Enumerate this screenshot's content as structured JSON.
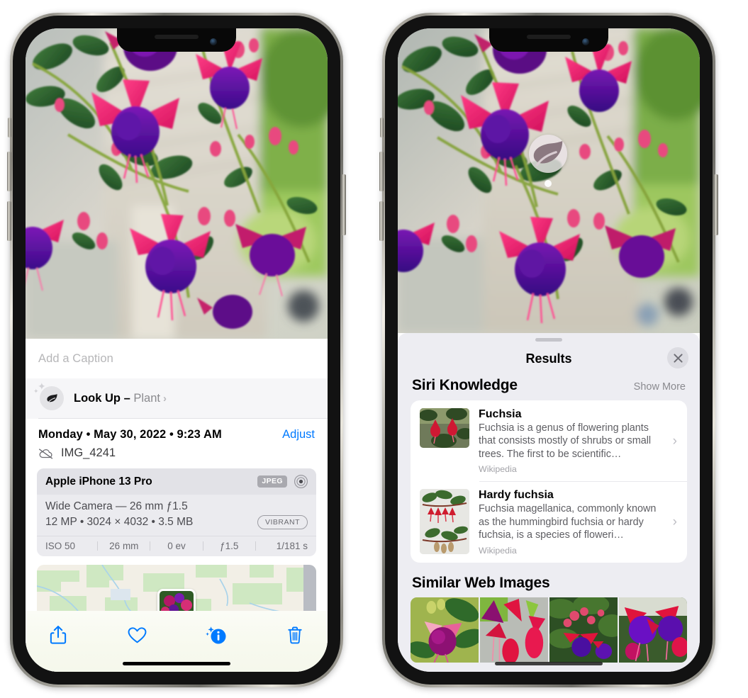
{
  "left_phone": {
    "name": "iPhone Photos detail view",
    "caption": {
      "placeholder": "Add a Caption",
      "value": ""
    },
    "look_up": {
      "icon": "leaf-icon",
      "label": "Look Up",
      "separator": "–",
      "subject": "Plant",
      "chevron": "›"
    },
    "metadata": {
      "date_line": "Monday • May 30, 2022 • 9:23 AM",
      "adjust_label": "Adjust",
      "cloud_icon": "cloud-slash-icon",
      "filename": "IMG_4241"
    },
    "camera_card": {
      "device": "Apple iPhone 13 Pro",
      "format_badge": "JPEG",
      "aperture_icon": "aperture-icon",
      "lens": "Wide Camera — 26 mm ƒ1.5",
      "specs": "12 MP • 3024 × 4032 • 3.5 MB",
      "style_badge": "VIBRANT",
      "exif": [
        "ISO 50",
        "26 mm",
        "0 ev",
        "ƒ1.5",
        "1/181 s"
      ]
    },
    "map": {
      "pin_label": "photo-pin"
    },
    "toolbar": [
      {
        "name": "share-button",
        "icon": "share-icon"
      },
      {
        "name": "favorite-button",
        "icon": "heart-icon"
      },
      {
        "name": "info-button",
        "icon": "info-sparkle-icon"
      },
      {
        "name": "delete-button",
        "icon": "trash-icon"
      }
    ]
  },
  "right_phone": {
    "name": "Visual Look Up results",
    "photo_badge": {
      "icon": "leaf-icon",
      "label": "visual-look-up-badge"
    },
    "sheet": {
      "title": "Results",
      "close_icon": "close-icon",
      "siri_knowledge": {
        "heading": "Siri Knowledge",
        "show_more": "Show More",
        "items": [
          {
            "title": "Fuchsia",
            "description": "Fuchsia is a genus of flowering plants that consists mostly of shrubs or small trees. The first to be scientific…",
            "source": "Wikipedia",
            "chevron": "›"
          },
          {
            "title": "Hardy fuchsia",
            "description": "Fuchsia magellanica, commonly known as the hummingbird fuchsia or hardy fuchsia, is a species of floweri…",
            "source": "Wikipedia",
            "chevron": "›"
          }
        ]
      },
      "similar_web_images": {
        "heading": "Similar Web Images",
        "thumbnails": [
          "fuchsia-thumb-1",
          "fuchsia-thumb-2",
          "fuchsia-thumb-3",
          "fuchsia-thumb-4"
        ]
      }
    }
  },
  "colors": {
    "accent_blue": "#007aff",
    "sheet_background": "#ededf2",
    "card_background": "#ffffff",
    "camera_card": "#ebebef",
    "muted_text": "#8a8a8e"
  }
}
